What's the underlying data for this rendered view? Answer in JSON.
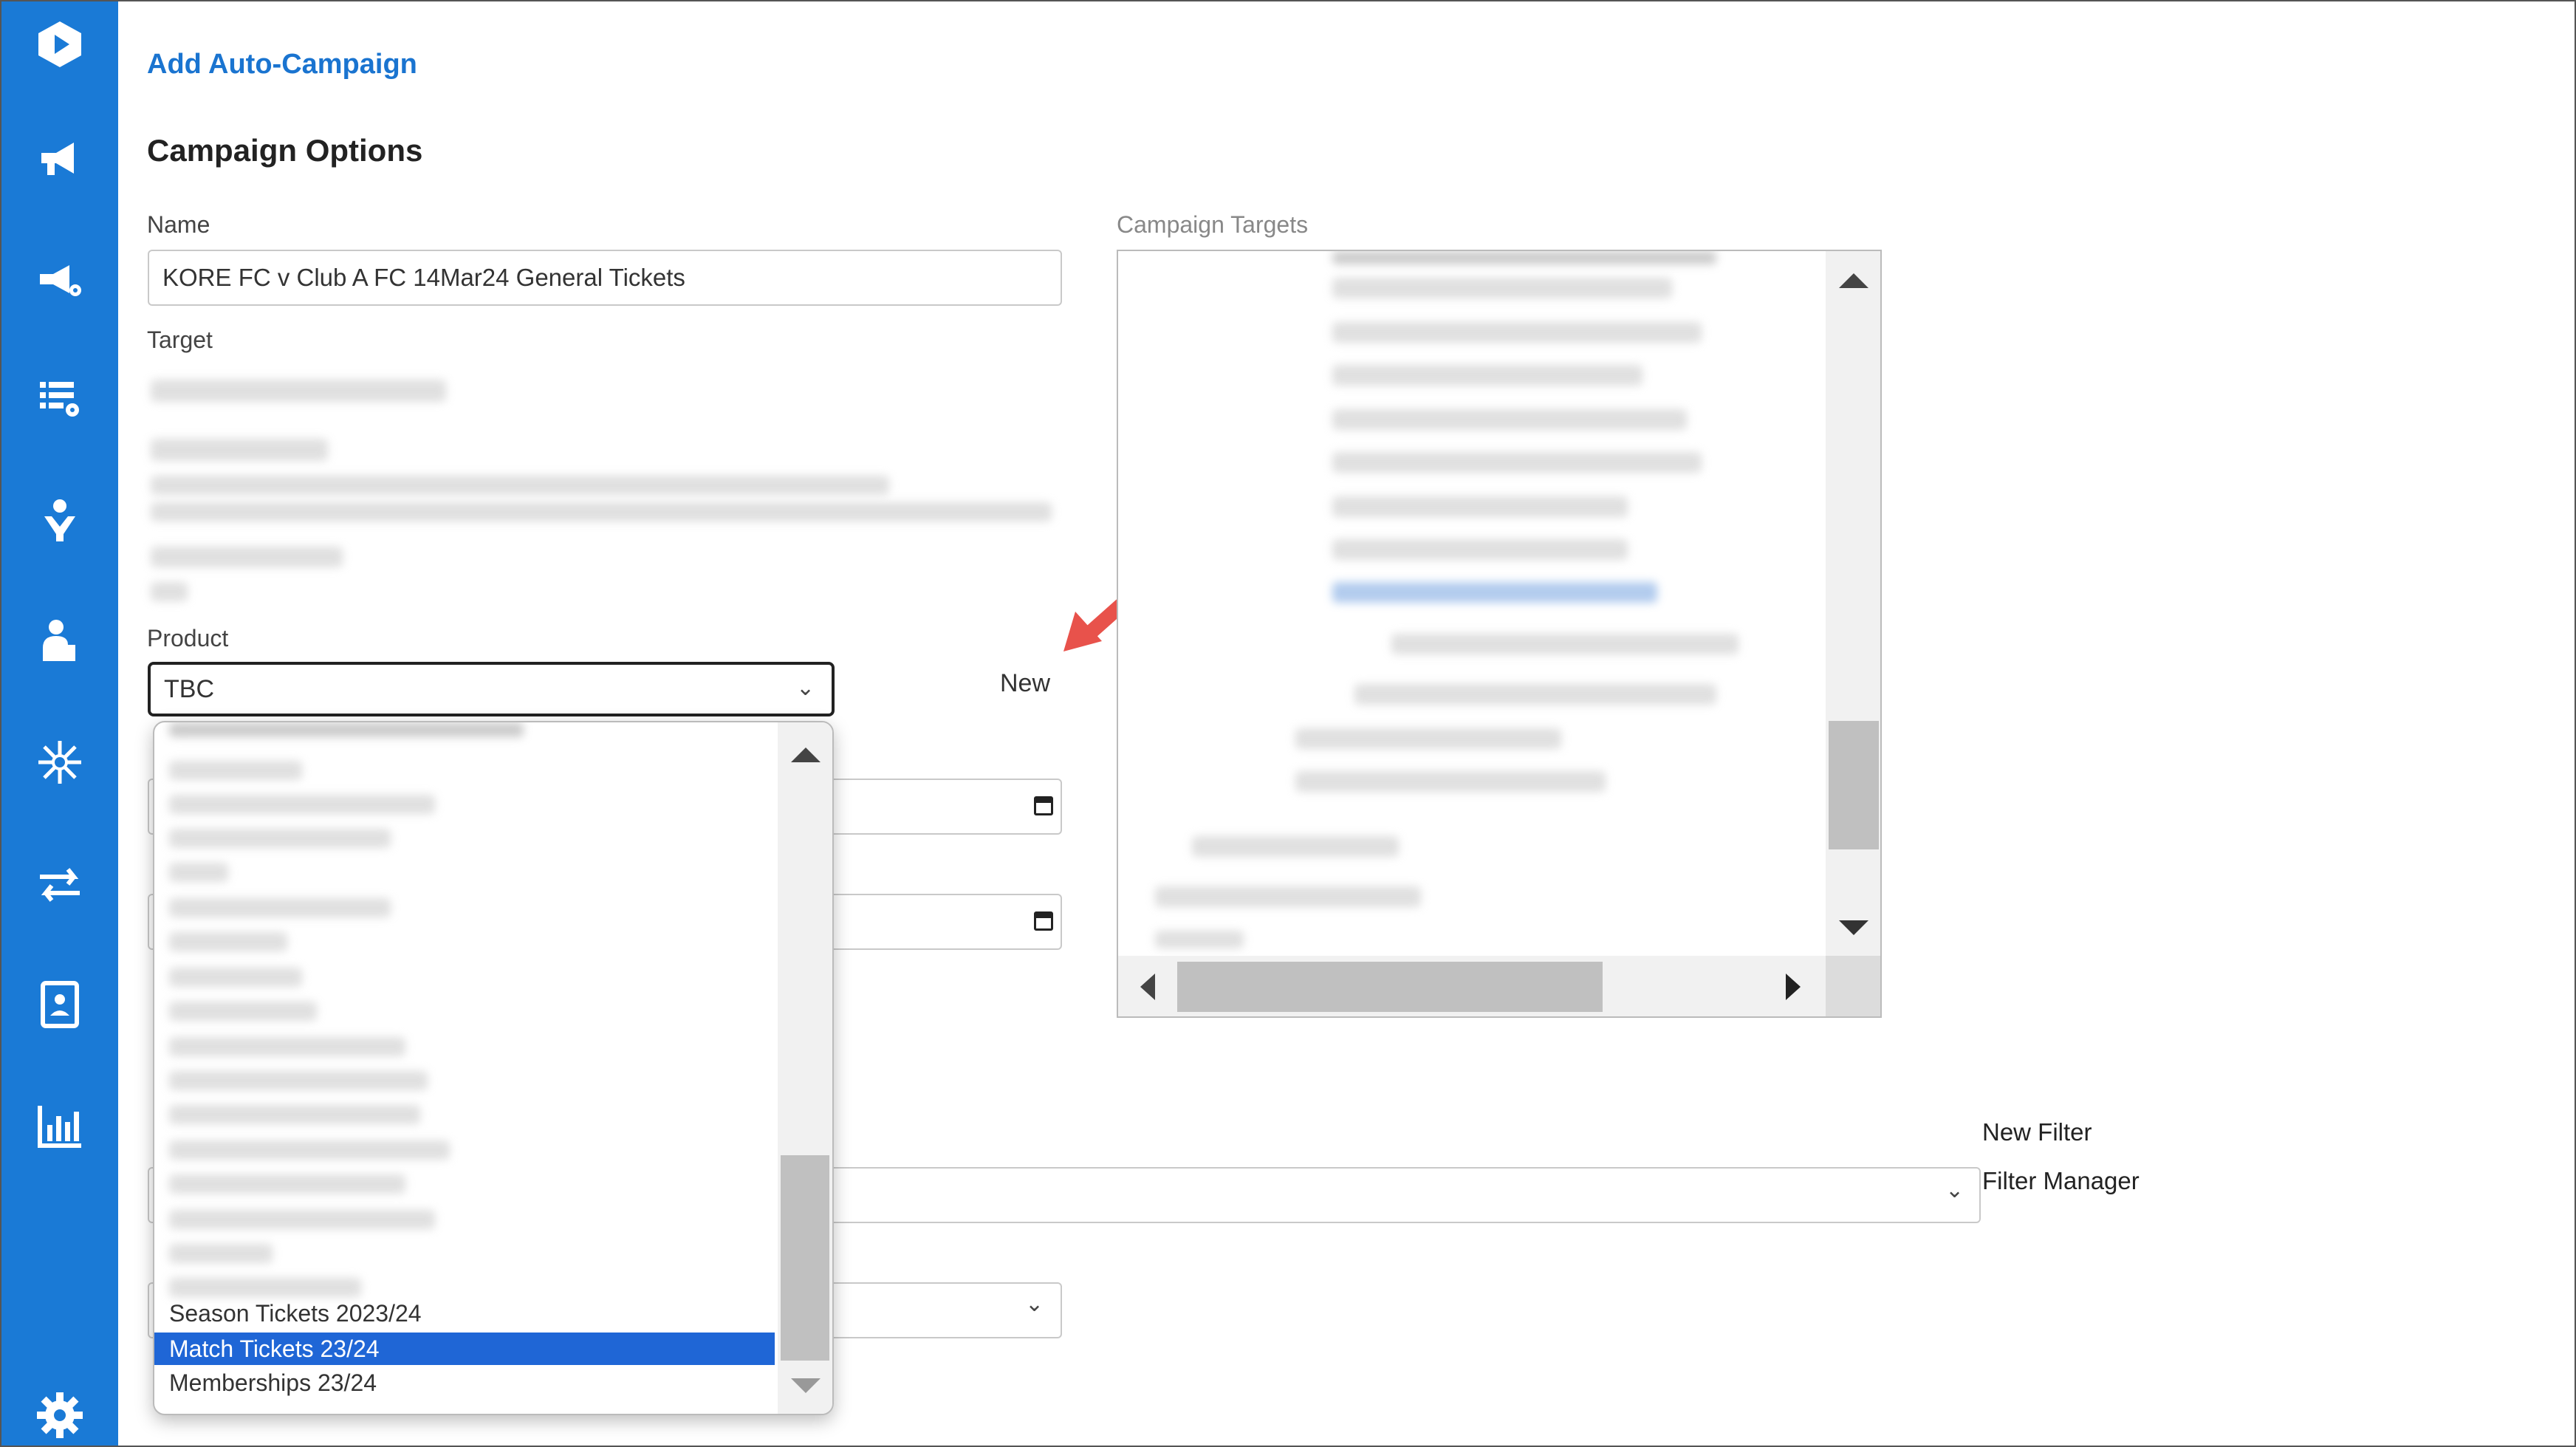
{
  "header": {
    "title": "Add Auto-Campaign"
  },
  "section": {
    "title": "Campaign Options"
  },
  "form": {
    "name_label": "Name",
    "name_value": "KORE FC v Club A FC 14Mar24 General Tickets",
    "target_label": "Target",
    "product_label": "Product",
    "product_value": "TBC",
    "new_product_link": "New"
  },
  "targets": {
    "label": "Campaign Targets"
  },
  "product_dropdown": {
    "visible_options": [
      "Season Tickets 2023/24",
      "Match Tickets 23/24",
      "Memberships 23/24"
    ],
    "selected": "Match Tickets 23/24"
  },
  "filters": {
    "new_filter": "New Filter",
    "filter_manager": "Filter Manager"
  },
  "colors": {
    "sidebar": "#1a7ad6",
    "accent": "#1a74d0",
    "selected_option": "#1f66d6",
    "arrow": "#e8524b"
  },
  "sidebar": {
    "icons": [
      "logo-icon",
      "megaphone-icon",
      "megaphone-settings-icon",
      "list-settings-icon",
      "user-heart-icon",
      "user-desk-icon",
      "network-settings-icon",
      "transfer-icon",
      "contact-card-icon",
      "bar-chart-icon",
      "gear-icon"
    ]
  }
}
